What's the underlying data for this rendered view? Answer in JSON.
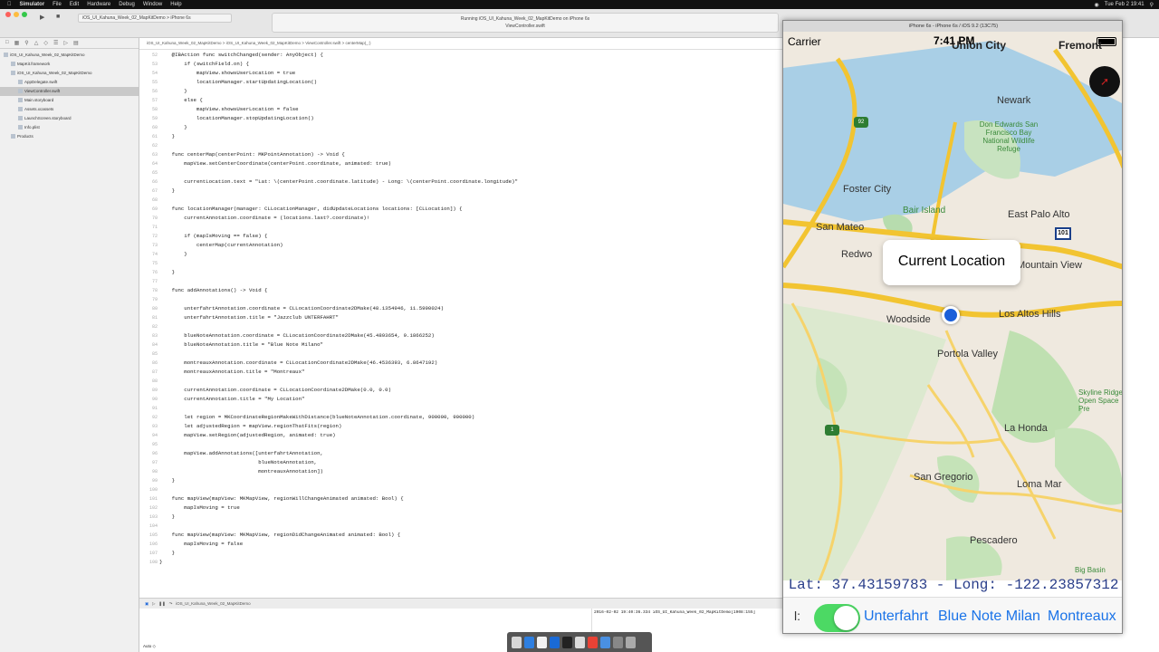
{
  "menubar": {
    "items": [
      "Simulator",
      "File",
      "Edit",
      "Hardware",
      "Debug",
      "Window",
      "Help"
    ],
    "clock": "Tue Feb 2  19:41"
  },
  "toolbar": {
    "scheme": "iOS_UI_Kahuna_Week_02_MapKitDemo  >  iPhone 6s",
    "activity": "Running iOS_UI_Kahuna_Week_02_MapKitDemo on iPhone 6s",
    "file": "ViewController.swift"
  },
  "navigator": {
    "items": [
      {
        "label": "iOS_UI_Kahuna_Week_02_MapKitDemo",
        "indent": 0,
        "selected": false
      },
      {
        "label": "MapKit.framework",
        "indent": 1,
        "selected": false
      },
      {
        "label": "iOS_UI_Kahuna_Week_02_MapKitDemo",
        "indent": 1,
        "selected": false
      },
      {
        "label": "AppDelegate.swift",
        "indent": 2,
        "selected": false
      },
      {
        "label": "ViewController.swift",
        "indent": 2,
        "selected": true
      },
      {
        "label": "Main.storyboard",
        "indent": 2,
        "selected": false
      },
      {
        "label": "Assets.xcassets",
        "indent": 2,
        "selected": false
      },
      {
        "label": "LaunchScreen.storyboard",
        "indent": 2,
        "selected": false
      },
      {
        "label": "Info.plist",
        "indent": 2,
        "selected": false
      },
      {
        "label": "Products",
        "indent": 1,
        "selected": false
      }
    ]
  },
  "editor": {
    "jumpbar": "iOS_UI_Kahuna_Week_02_MapKitDemo  >  iOS_UI_Kahuna_Week_02_MapKitDemo  >  ViewController.swift  >  centerMap(_:)",
    "first_line": 52,
    "lines": [
      "    @IBAction func switchChanged(sender: AnyObject) {",
      "        if (switchField.on) {",
      "            mapView.showsUserLocation = true",
      "            locationManager.startUpdatingLocation()",
      "        }",
      "        else {",
      "            mapView.showsUserLocation = false",
      "            locationManager.stopUpdatingLocation()",
      "        }",
      "    }",
      "",
      "    func centerMap(centerPoint: MKPointAnnotation) -> Void {",
      "        mapView.setCenterCoordinate(centerPoint.coordinate, animated: true)",
      "",
      "        currentLocation.text = \"Lat: \\(centerPoint.coordinate.latitude) - Long: \\(centerPoint.coordinate.longitude)\"",
      "    }",
      "",
      "    func locationManager(manager: CLLocationManager, didUpdateLocations locations: [CLLocation]) {",
      "        currentAnnotation.coordinate = (locations.last?.coordinate)!",
      "",
      "        if (mapIsMoving == false) {",
      "            centerMap(currentAnnotation)",
      "        }",
      "",
      "    }",
      "",
      "    func addAnnotations() -> Void {",
      "",
      "        unterfahrtAnnotation.coordinate = CLLocationCoordinate2DMake(48.1354946, 11.5990024)",
      "        unterfahrtAnnotation.title = \"Jazzclub UNTERFAHRT\"",
      "",
      "        blueNoteAnnotation.coordinate = CLLocationCoordinate2DMake(45.4893654, 9.1866252)",
      "        blueNoteAnnotation.title = \"Blue Note Milano\"",
      "",
      "        montreauxAnnotation.coordinate = CLLocationCoordinate2DMake(46.4536393, 6.8647192)",
      "        montreauxAnnotation.title = \"Montreaux\"",
      "",
      "        currentAnnotation.coordinate = CLLocationCoordinate2DMake(0.0, 0.0)",
      "        currentAnnotation.title = \"My Location\"",
      "",
      "        let region = MKCoordinateRegionMakeWithDistance(blueNoteAnnotation.coordinate, 900000, 900000)",
      "        let adjustedRegion = mapView.regionThatFits(region)",
      "        mapView.setRegion(adjustedRegion, animated: true)",
      "",
      "        mapView.addAnnotations([unterfahrtAnnotation,",
      "                                blueNoteAnnotation,",
      "                                montreauxAnnotation])",
      "    }",
      "",
      "    func mapView(mapView: MKMapView, regionWillChangeAnimated animated: Bool) {",
      "        mapIsMoving = true",
      "    }",
      "",
      "    func mapView(mapView: MKMapView, regionDidChangeAnimated animated: Bool) {",
      "        mapIsMoving = false",
      "    }",
      "}"
    ]
  },
  "debug": {
    "bar": "iOS_UI_Kahuna_Week_02_MapKitDemo",
    "console_line": "2016-02-02 19:40:36.334 iOS_UI_Kahuna_Week_02_MapKitDemo[1908:155]",
    "auto": "Auto ◇"
  },
  "simulator": {
    "title": "iPhone 6s - iPhone 6s / iOS 9.2 (13C75)",
    "carrier": "Carrier",
    "time": "7:41 PM",
    "callout": "Current Location",
    "readout": "Lat: 37.43159783 - Long: -122.23857312",
    "bottom_label": "l:",
    "switch_on": true,
    "buttons": [
      "Unterfahrt",
      "Blue Note Milan",
      "Montreaux"
    ],
    "places": [
      "Union City",
      "Fremont",
      "Newark",
      "Foster City",
      "San Mateo",
      "East Palo Alto",
      "Redwo",
      "Mountain View",
      "Woodside",
      "Los Altos Hills",
      "Portola Valley",
      "La Honda",
      "San Gregorio",
      "Loma Mar",
      "Pescadero"
    ],
    "parks": [
      "Don Edwards San Francisco Bay National Wildlife Refuge",
      "Bair Island",
      "Skyline Ridge Open Space Pre",
      "Big Basin"
    ],
    "shields": [
      "92",
      "1",
      "101"
    ]
  }
}
